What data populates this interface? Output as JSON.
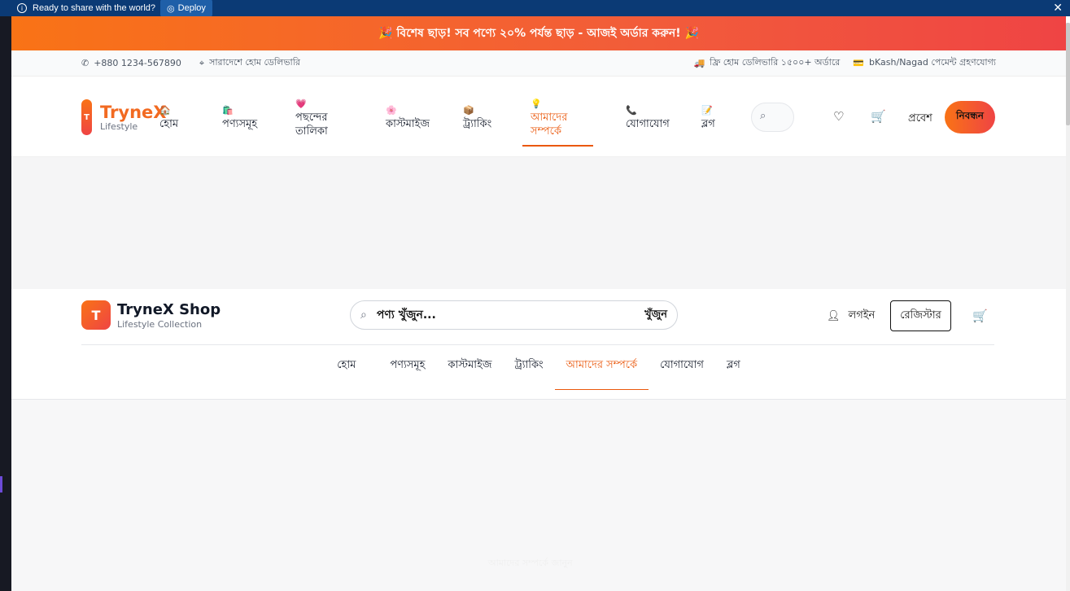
{
  "deploy_bar": {
    "message": "Ready to share with the world?",
    "deploy_label": "Deploy",
    "close": "✕"
  },
  "promo": {
    "text": "🎉 বিশেষ ছাড়! সব পণ্যে ২০% পর্যন্ত ছাড় - আজই অর্ডার করুন! 🎉"
  },
  "topinfo": {
    "phone": "+880 1234-567890",
    "location": "সারাদেশে হোম ডেলিভারি",
    "delivery": "ফ্রি হোম ডেলিভারি ১৫০০+ অর্ডারে",
    "payment": "bKash/Nagad পেমেন্ট গ্রহণযোগ্য"
  },
  "header1": {
    "logo_letter": "T",
    "logo_name": "TryneX",
    "logo_sub": "Lifestyle",
    "nav": [
      {
        "icon": "🏠",
        "label": "হোম"
      },
      {
        "icon": "🛍️",
        "label": "পণ্যসমূহ"
      },
      {
        "icon": "💗",
        "label": "পছন্দের তালিকা"
      },
      {
        "icon": "🌸",
        "label": "কাস্টমাইজ"
      },
      {
        "icon": "📦",
        "label": "ট্র্যাকিং"
      },
      {
        "icon": "💡",
        "label": "আমাদের সম্পর্কে"
      },
      {
        "icon": "📞",
        "label": "যোগাযোগ"
      },
      {
        "icon": "📝",
        "label": "ব্লগ"
      }
    ],
    "login": "প্রবেশ",
    "register": "নিবন্ধন"
  },
  "header2": {
    "logo_letter": "T",
    "logo_name": "TryneX Shop",
    "logo_sub": "Lifestyle Collection",
    "search_placeholder": "পণ্য খুঁজুন...",
    "search_button": "খুঁজুন",
    "login": "লগইন",
    "register": "রেজিস্টার",
    "nav": [
      "হোম",
      "পণ্যসমূহ",
      "কাস্টমাইজ",
      "ট্র্যাকিং",
      "আমাদের সম্পর্কে",
      "যোগাযোগ",
      "ব্লগ"
    ]
  },
  "content": {
    "faint_text": "আমাদের সম্পর্কে জানুন"
  },
  "colors": {
    "accent": "#ea580c",
    "gradient_start": "#f97316",
    "gradient_end": "#ef4444",
    "deploy_bar": "#0b3a75"
  }
}
